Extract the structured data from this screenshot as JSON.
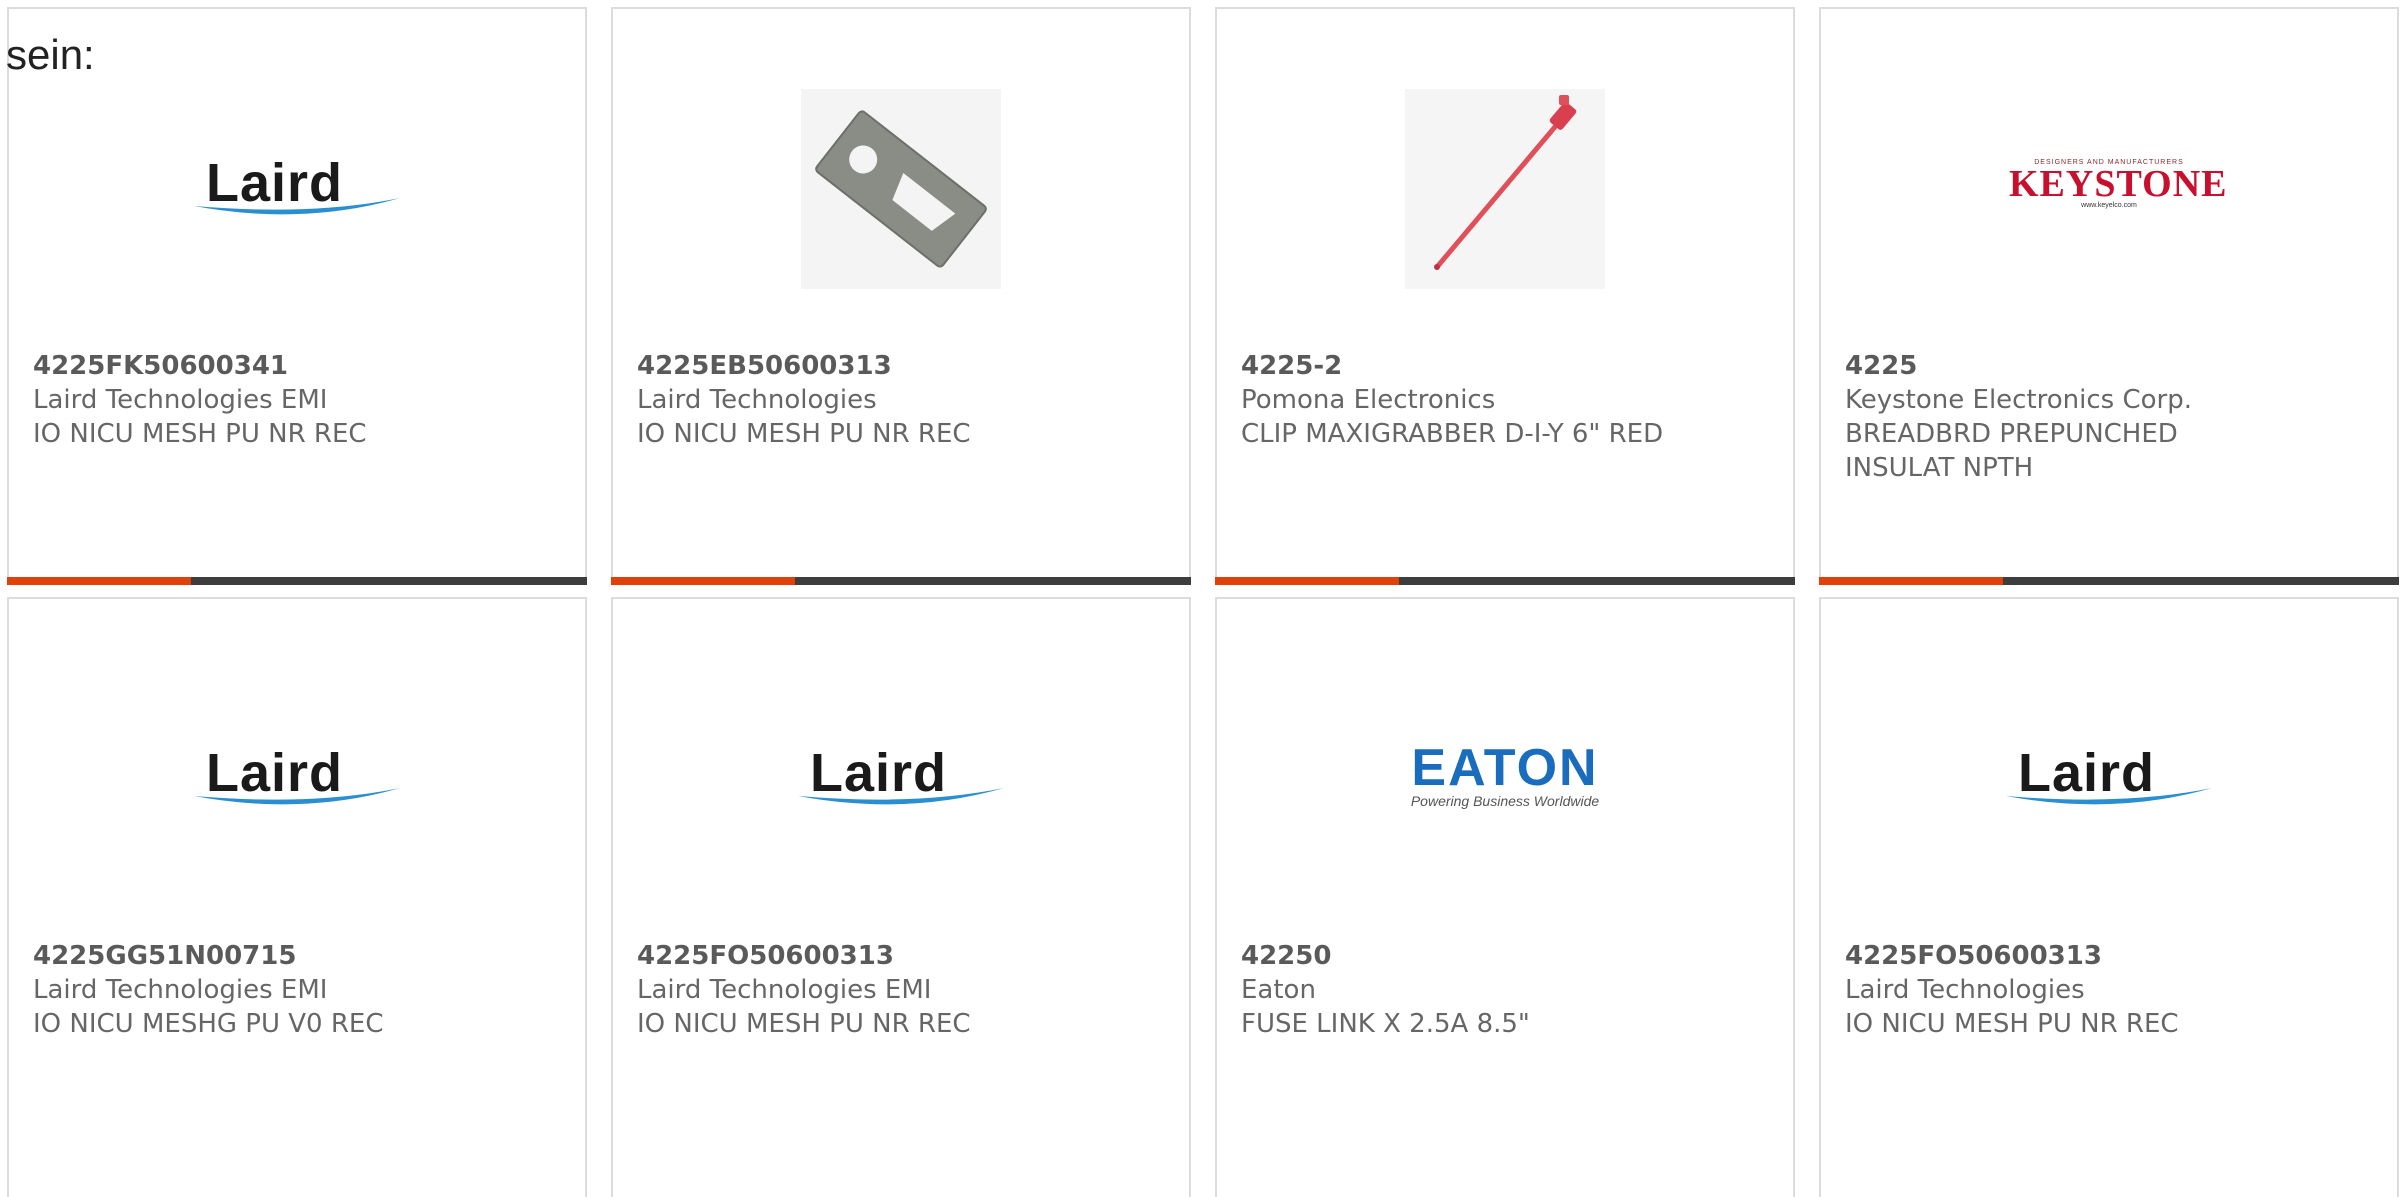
{
  "intro_text": "sein:",
  "brands": {
    "laird": "Laird",
    "keystone": "KEYSTONE",
    "keystone_tagline": "DESIGNERS AND MANUFACTURERS",
    "keystone_url": "www.keyelco.com",
    "eaton": "EATON",
    "eaton_tagline": "Powering Business Worldwide"
  },
  "colors": {
    "accent": "#e0400a",
    "bar_dark": "#3d3d3d",
    "laird_swoosh": "#2a8fd0",
    "keystone_red": "#c8102e",
    "eaton_blue": "#1a6dbd",
    "probe_red": "#e0505a"
  },
  "products": [
    {
      "part_number": "4225FK50600341",
      "manufacturer": "Laird Technologies EMI",
      "description": "IO NICU MESH PU NR REC",
      "image": "laird-logo"
    },
    {
      "part_number": "4225EB50600313",
      "manufacturer": "Laird Technologies",
      "description": "IO NICU MESH PU NR REC",
      "image": "gasket-photo"
    },
    {
      "part_number": "4225-2",
      "manufacturer": "Pomona Electronics",
      "description": "CLIP MAXIGRABBER D-I-Y 6\" RED",
      "image": "test-clip-photo"
    },
    {
      "part_number": "4225",
      "manufacturer": "Keystone Electronics Corp.",
      "description": "BREADBRD PREPUNCHED INSULAT NPTH",
      "image": "keystone-logo"
    },
    {
      "part_number": "4225GG51N00715",
      "manufacturer": "Laird Technologies EMI",
      "description": "IO NICU MESHG PU V0 REC",
      "image": "laird-logo"
    },
    {
      "part_number": "4225FO50600313",
      "manufacturer": "Laird Technologies EMI",
      "description": "IO NICU MESH PU NR REC",
      "image": "laird-logo"
    },
    {
      "part_number": "42250",
      "manufacturer": "Eaton",
      "description": "FUSE LINK X 2.5A 8.5\"",
      "image": "eaton-logo"
    },
    {
      "part_number": "4225FO50600313",
      "manufacturer": "Laird Technologies",
      "description": "IO NICU MESH PU NR REC",
      "image": "laird-logo"
    }
  ]
}
